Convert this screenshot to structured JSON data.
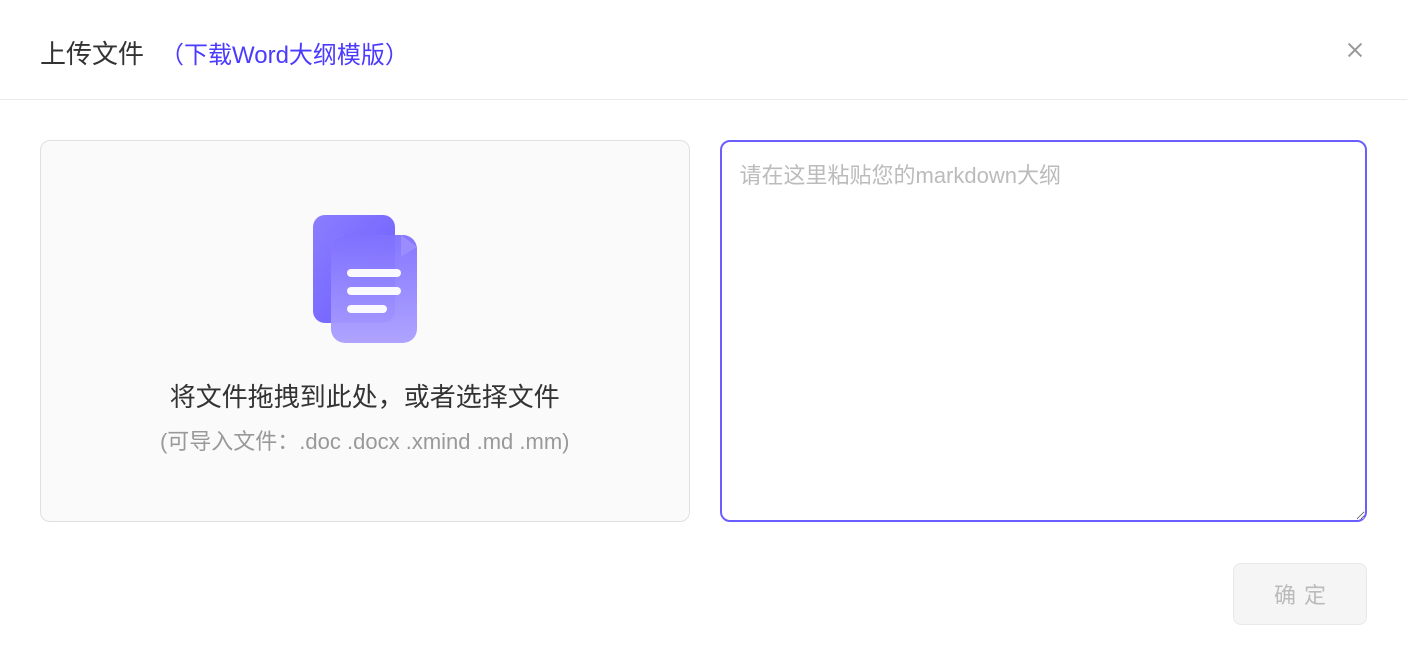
{
  "header": {
    "title": "上传文件",
    "download_link": "（下载Word大纲模版）"
  },
  "dropzone": {
    "main_text": "将文件拖拽到此处，或者选择文件",
    "hint_text": "(可导入文件：.doc .docx .xmind .md .mm)"
  },
  "textarea": {
    "placeholder": "请在这里粘贴您的markdown大纲",
    "value": ""
  },
  "footer": {
    "confirm_label": "确定"
  }
}
